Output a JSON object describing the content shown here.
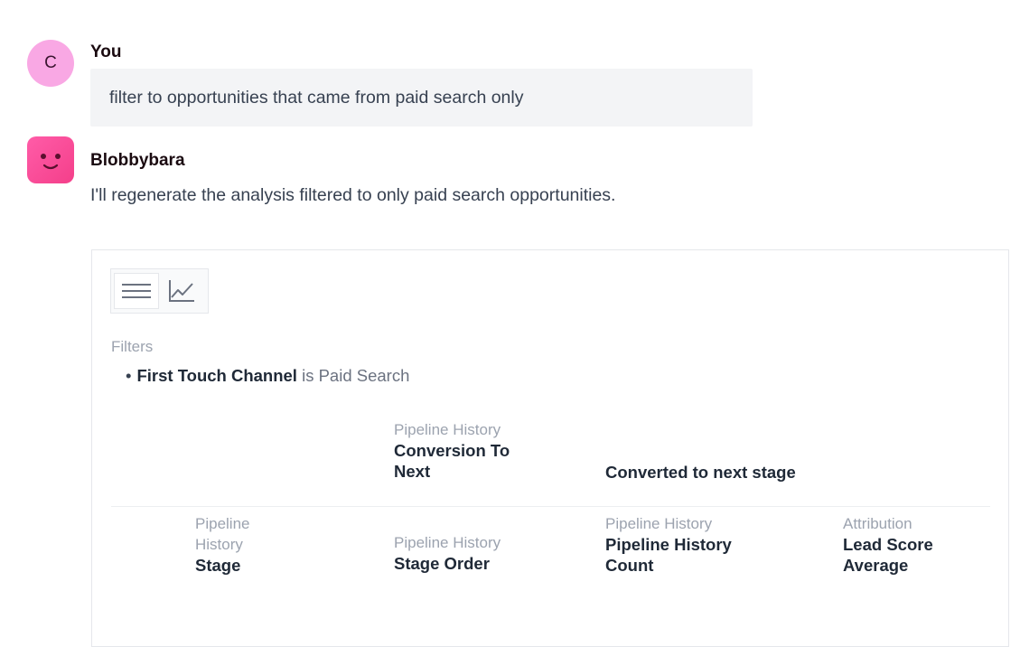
{
  "user_message": {
    "avatar_initial": "C",
    "author": "You",
    "text": "filter to opportunities that came from paid search only"
  },
  "bot_message": {
    "author": "Blobbybara",
    "text": "I'll regenerate the analysis filtered to only paid search opportunities."
  },
  "result_card": {
    "view_toggle": {
      "table_icon": "table-lines-icon",
      "chart_icon": "line-chart-icon",
      "active": "table"
    },
    "filters_label": "Filters",
    "filter": {
      "field": "First Touch Channel",
      "condition": "is Paid Search"
    },
    "header_row_1": [
      {
        "sub": "Pipeline History",
        "main": "Conversion To Next"
      },
      {
        "sub": "",
        "main": "Converted to next stage"
      }
    ],
    "header_row_2": [
      {
        "sub": "Pipeline History",
        "main": "Stage"
      },
      {
        "sub": "Pipeline History",
        "main": "Stage Order"
      },
      {
        "sub": "Pipeline History",
        "main": "Pipeline History Count"
      },
      {
        "sub": "Attribution",
        "main": "Lead Score Average"
      }
    ]
  },
  "colors": {
    "user_avatar": "#f9a8e4",
    "bot_avatar": "#f43f8a",
    "user_bubble": "#f3f4f6"
  }
}
